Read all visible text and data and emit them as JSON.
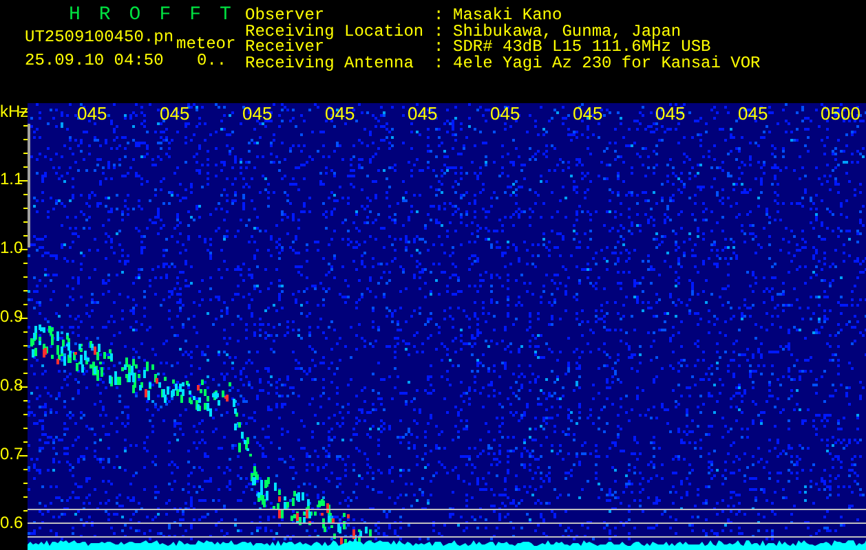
{
  "app_title": "HROFFT",
  "file": {
    "name": "UT2509100450.pn",
    "type": "meteor",
    "timestamp": "25.09.10 04:50",
    "count": "0.."
  },
  "info": [
    {
      "label": "Observer",
      "sep": ":",
      "value": "Masaki Kano"
    },
    {
      "label": "Receiving Location",
      "sep": ":",
      "value": "Shibukawa, Gunma, Japan"
    },
    {
      "label": "Receiver",
      "sep": ":",
      "value": "SDR# 43dB L15 111.6MHz USB"
    },
    {
      "label": "Receiving Antenna",
      "sep": ":",
      "value": "4ele Yagi Az 230 for Kansai VOR"
    }
  ],
  "spectrogram": {
    "unit": "kHz",
    "time_labels": [
      "045",
      "045",
      "045",
      "045",
      "045",
      "045",
      "045",
      "045",
      "045",
      "0500"
    ],
    "freq_labels": [
      "1.1",
      "1.0",
      "0.9",
      "0.8",
      "0.7",
      "0.6"
    ]
  }
}
